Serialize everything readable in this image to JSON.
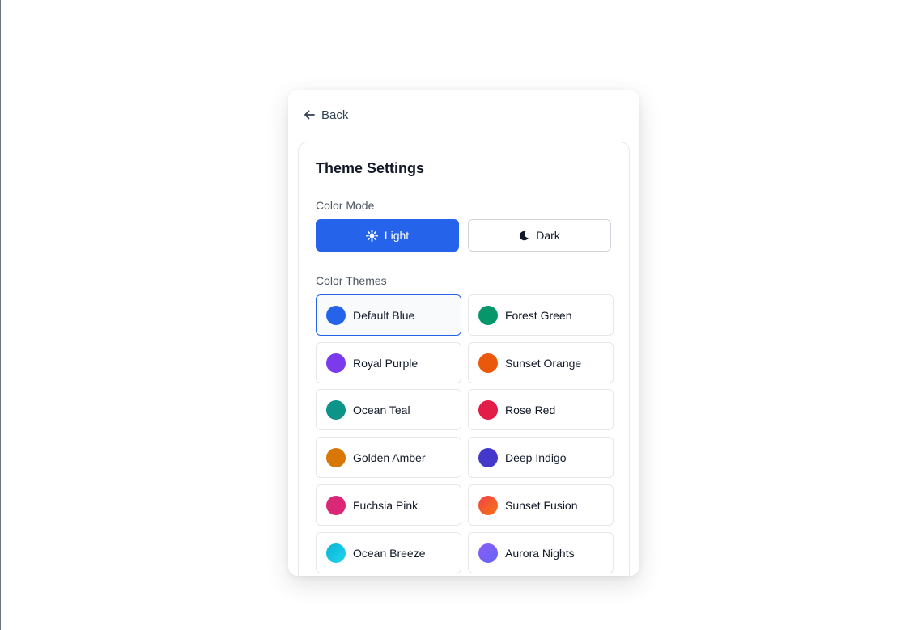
{
  "nav": {
    "back_label": "Back"
  },
  "settings": {
    "title": "Theme Settings",
    "color_mode_label": "Color Mode",
    "modes": [
      {
        "label": "Light",
        "icon": "sun-icon",
        "selected": true
      },
      {
        "label": "Dark",
        "icon": "moon-icon",
        "selected": false
      }
    ],
    "color_themes_label": "Color Themes",
    "themes": [
      {
        "name": "Default Blue",
        "color": "#2563eb",
        "selected": true
      },
      {
        "name": "Forest Green",
        "color": "#059669",
        "selected": false
      },
      {
        "name": "Royal Purple",
        "color": "#7c3aed",
        "selected": false
      },
      {
        "name": "Sunset Orange",
        "color": "#ea580c",
        "selected": false
      },
      {
        "name": "Ocean Teal",
        "color": "#0d9488",
        "selected": false
      },
      {
        "name": "Rose Red",
        "color": "#e11d48",
        "selected": false
      },
      {
        "name": "Golden Amber",
        "color": "#d97706",
        "selected": false
      },
      {
        "name": "Deep Indigo",
        "color": "#4338ca",
        "selected": false
      },
      {
        "name": "Fuchsia Pink",
        "color": "#db2777",
        "selected": false
      },
      {
        "name": "Sunset Fusion",
        "color": "#ef4444",
        "color2": "#f97316",
        "selected": false
      },
      {
        "name": "Ocean Breeze",
        "color": "#06b6d4",
        "color2": "#22d3ee",
        "selected": false
      },
      {
        "name": "Aurora Nights",
        "color": "#8b5cf6",
        "color2": "#6366f1",
        "selected": false
      }
    ]
  },
  "colors": {
    "accent": "#2563eb",
    "border": "#e5e7eb"
  }
}
